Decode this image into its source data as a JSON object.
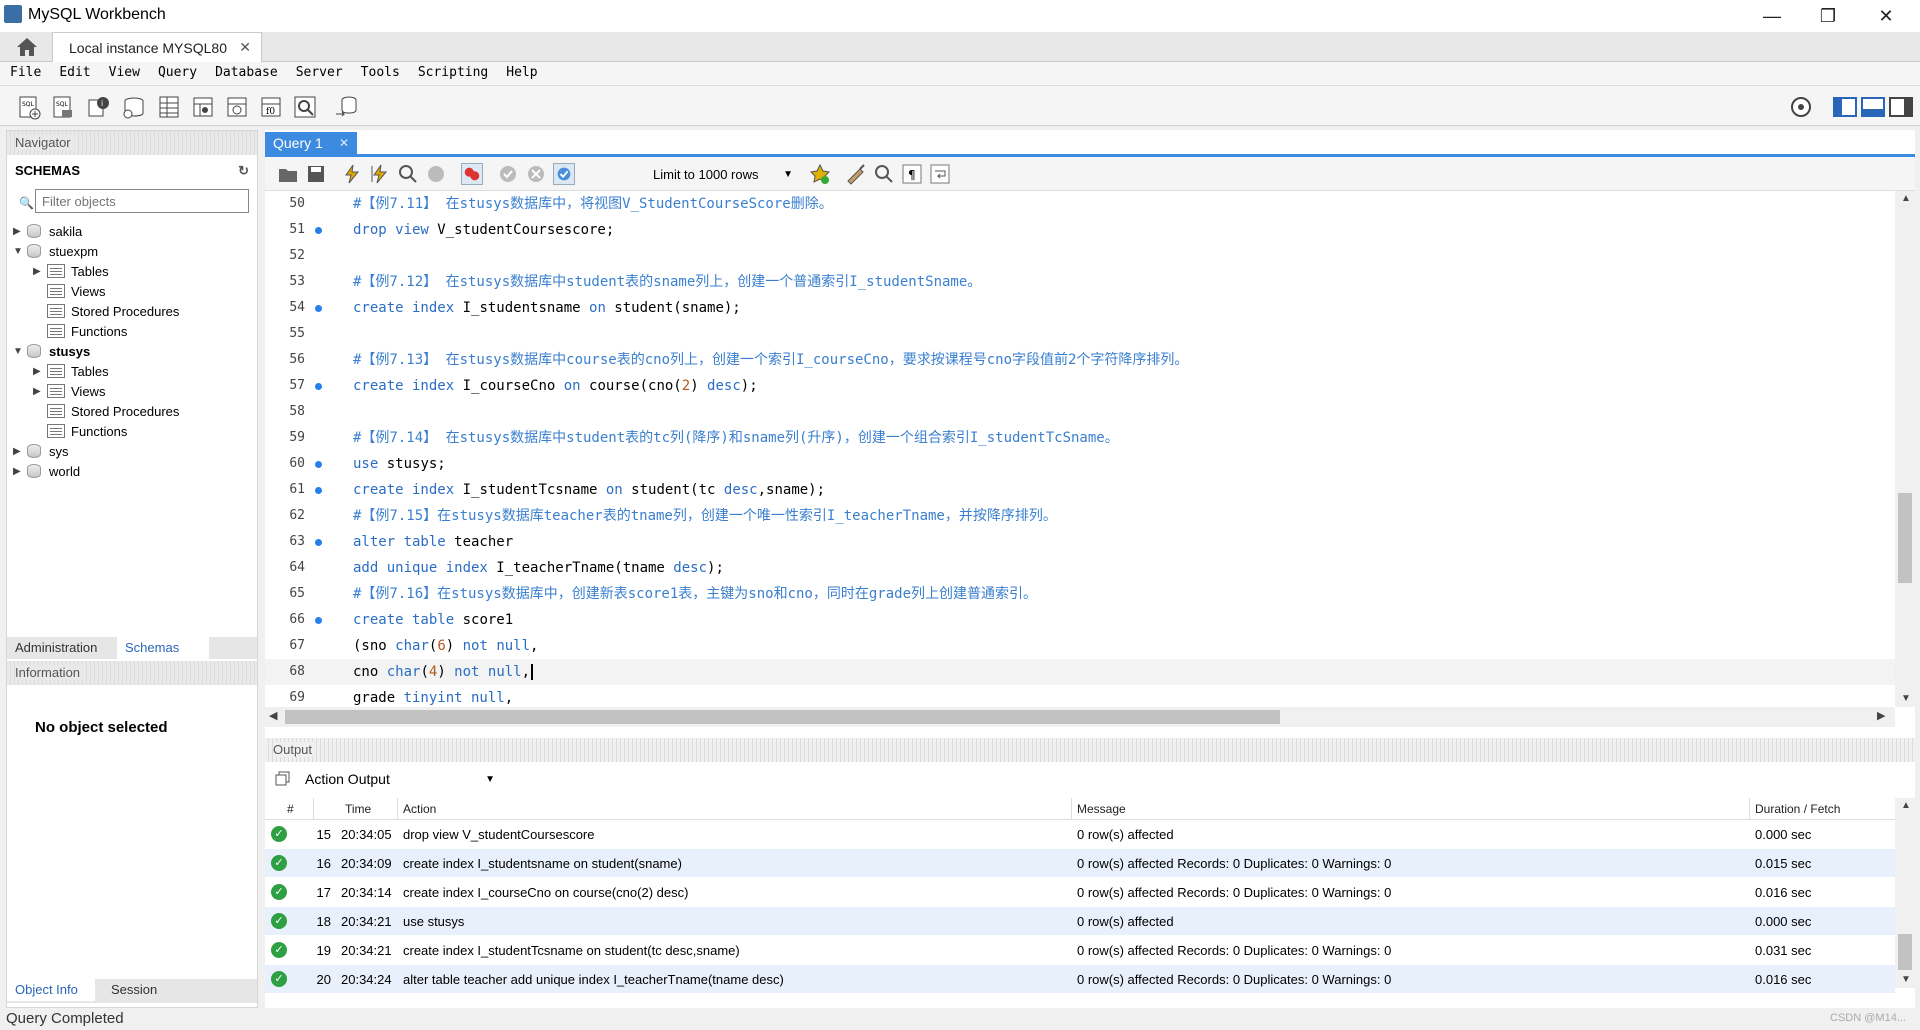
{
  "window": {
    "title": "MySQL Workbench"
  },
  "connection_tab": {
    "label": "Local instance MYSQL80"
  },
  "menu": [
    "File",
    "Edit",
    "View",
    "Query",
    "Database",
    "Server",
    "Tools",
    "Scripting",
    "Help"
  ],
  "navigator": {
    "title": "Navigator",
    "schemas_label": "SCHEMAS",
    "filter_placeholder": "Filter objects",
    "tree": [
      {
        "label": "sakila",
        "bold": false
      },
      {
        "label": "stuexpm",
        "bold": false
      },
      {
        "label": "Tables"
      },
      {
        "label": "Views"
      },
      {
        "label": "Stored Procedures"
      },
      {
        "label": "Functions"
      },
      {
        "label": "stusys",
        "bold": true
      },
      {
        "label": "Tables"
      },
      {
        "label": "Views"
      },
      {
        "label": "Stored Procedures"
      },
      {
        "label": "Functions"
      },
      {
        "label": "sys"
      },
      {
        "label": "world"
      }
    ],
    "tabs": [
      "Administration",
      "Schemas"
    ],
    "information_title": "Information",
    "no_object": "No object selected",
    "bottom_tabs": [
      "Object Info",
      "Session"
    ]
  },
  "query_tab": {
    "label": "Query 1"
  },
  "limit": {
    "label": "Limit to 1000 rows"
  },
  "editor": {
    "lines": [
      {
        "n": "50",
        "dot": false,
        "html": "<span class='cm'>#【例7.11】 在stusys数据库中，将视图V_StudentCourseScore删除。</span>"
      },
      {
        "n": "51",
        "dot": true,
        "html": "<span class='kw'>drop view</span> V_studentCoursescore;"
      },
      {
        "n": "52",
        "dot": false,
        "html": ""
      },
      {
        "n": "53",
        "dot": false,
        "html": "<span class='cm'>#【例7.12】 在stusys数据库中student表的sname列上，创建一个普通索引I_studentSname。</span>"
      },
      {
        "n": "54",
        "dot": true,
        "html": "<span class='kw'>create index</span> I_studentsname <span class='kw'>on</span> student(sname);"
      },
      {
        "n": "55",
        "dot": false,
        "html": ""
      },
      {
        "n": "56",
        "dot": false,
        "html": "<span class='cm'>#【例7.13】 在stusys数据库中course表的cno列上，创建一个索引I_courseCno，要求按课程号cno字段值前2个字符降序排列。</span>"
      },
      {
        "n": "57",
        "dot": true,
        "html": "<span class='kw'>create index</span> I_courseCno <span class='kw'>on</span> course(cno(<span class='num'>2</span>) <span class='kw'>desc</span>);"
      },
      {
        "n": "58",
        "dot": false,
        "html": ""
      },
      {
        "n": "59",
        "dot": false,
        "html": "<span class='cm'>#【例7.14】 在stusys数据库中student表的tc列(降序)和sname列(升序)，创建一个组合索引I_studentTcSname。</span>"
      },
      {
        "n": "60",
        "dot": true,
        "html": "<span class='kw'>use</span> stusys;"
      },
      {
        "n": "61",
        "dot": true,
        "html": "<span class='kw'>create index</span> I_studentTcsname <span class='kw'>on</span> student(tc <span class='kw'>desc</span>,sname);"
      },
      {
        "n": "62",
        "dot": false,
        "html": "<span class='cm'>#【例7.15】在stusys数据库teacher表的tname列，创建一个唯一性索引I_teacherTname，并按降序排列。</span>"
      },
      {
        "n": "63",
        "dot": true,
        "html": "<span class='kw'>alter table</span> teacher"
      },
      {
        "n": "64",
        "dot": false,
        "html": "<span class='kw'>add unique index</span> I_teacherTname(tname <span class='kw'>desc</span>);"
      },
      {
        "n": "65",
        "dot": false,
        "html": "<span class='cm'>#【例7.16】在stusys数据库中，创建新表score1表，主键为sno和cno，同时在grade列上创建普通索引。</span>"
      },
      {
        "n": "66",
        "dot": true,
        "html": "<span class='kw'>create table</span> score1"
      },
      {
        "n": "67",
        "dot": false,
        "html": "(sno <span class='kw'>char</span>(<span class='num'>6</span>) <span class='kw'>not null</span>,"
      },
      {
        "n": "68",
        "dot": false,
        "html": "cno <span class='kw'>char</span>(<span class='num'>4</span>) <span class='kw'>not null</span>,"
      },
      {
        "n": "69",
        "dot": false,
        "html": "grade <span class='kw'>tinyint null</span>,"
      }
    ]
  },
  "output": {
    "title": "Output",
    "selector": "Action Output",
    "headers": {
      "num": "#",
      "time": "Time",
      "action": "Action",
      "message": "Message",
      "duration": "Duration / Fetch"
    },
    "rows": [
      {
        "num": "15",
        "time": "20:34:05",
        "action": "drop view V_studentCoursescore",
        "message": "0 row(s) affected",
        "duration": "0.000 sec"
      },
      {
        "num": "16",
        "time": "20:34:09",
        "action": "create index I_studentsname on student(sname)",
        "message": "0 row(s) affected Records: 0  Duplicates: 0  Warnings: 0",
        "duration": "0.015 sec"
      },
      {
        "num": "17",
        "time": "20:34:14",
        "action": "create index I_courseCno on course(cno(2) desc)",
        "message": "0 row(s) affected Records: 0  Duplicates: 0  Warnings: 0",
        "duration": "0.016 sec"
      },
      {
        "num": "18",
        "time": "20:34:21",
        "action": "use stusys",
        "message": "0 row(s) affected",
        "duration": "0.000 sec"
      },
      {
        "num": "19",
        "time": "20:34:21",
        "action": "create index I_studentTcsname on student(tc desc,sname)",
        "message": "0 row(s) affected Records: 0  Duplicates: 0  Warnings: 0",
        "duration": "0.031 sec"
      },
      {
        "num": "20",
        "time": "20:34:24",
        "action": "alter table teacher add unique index I_teacherTname(tname desc)",
        "message": "0 row(s) affected Records: 0  Duplicates: 0  Warnings: 0",
        "duration": "0.016 sec"
      }
    ]
  },
  "status": {
    "text": "Query Completed"
  },
  "watermark": "CSDN @M14..."
}
